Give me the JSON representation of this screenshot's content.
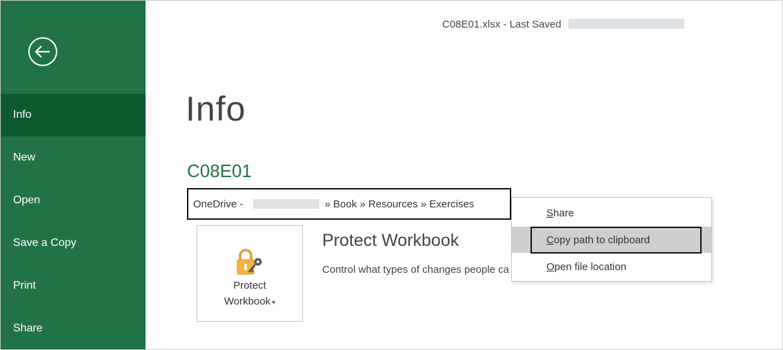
{
  "title_bar": {
    "document_name": "C08E01.xlsx",
    "separator": "-",
    "last_saved_label": "Last Saved"
  },
  "sidebar": {
    "items": [
      {
        "label": "Info",
        "active": true
      },
      {
        "label": "New",
        "active": false
      },
      {
        "label": "Open",
        "active": false
      },
      {
        "label": "Save a Copy",
        "active": false
      },
      {
        "label": "Print",
        "active": false
      },
      {
        "label": "Share",
        "active": false
      }
    ]
  },
  "main": {
    "page_title": "Info",
    "file_name": "C08E01",
    "path": {
      "prefix": "OneDrive -",
      "suffix": "» Book » Resources » Exercises"
    },
    "protect": {
      "tile_label_line1": "Protect",
      "tile_label_line2": "Workbook",
      "caret": "▾",
      "heading": "Protect Workbook",
      "description": "Control what types of changes people can make to this workbook."
    }
  },
  "context_menu": {
    "items": [
      {
        "accel": "S",
        "rest": "hare"
      },
      {
        "accel": "C",
        "rest": "opy path to clipboard"
      },
      {
        "accel": "O",
        "rest": "pen file location"
      }
    ]
  },
  "colors": {
    "brand": "#217346",
    "sidebar_active": "#0d5a2e",
    "menu_hover": "#cfcfcf"
  },
  "icons": {
    "back": "back-arrow-icon",
    "protect": "lock-key-icon"
  }
}
